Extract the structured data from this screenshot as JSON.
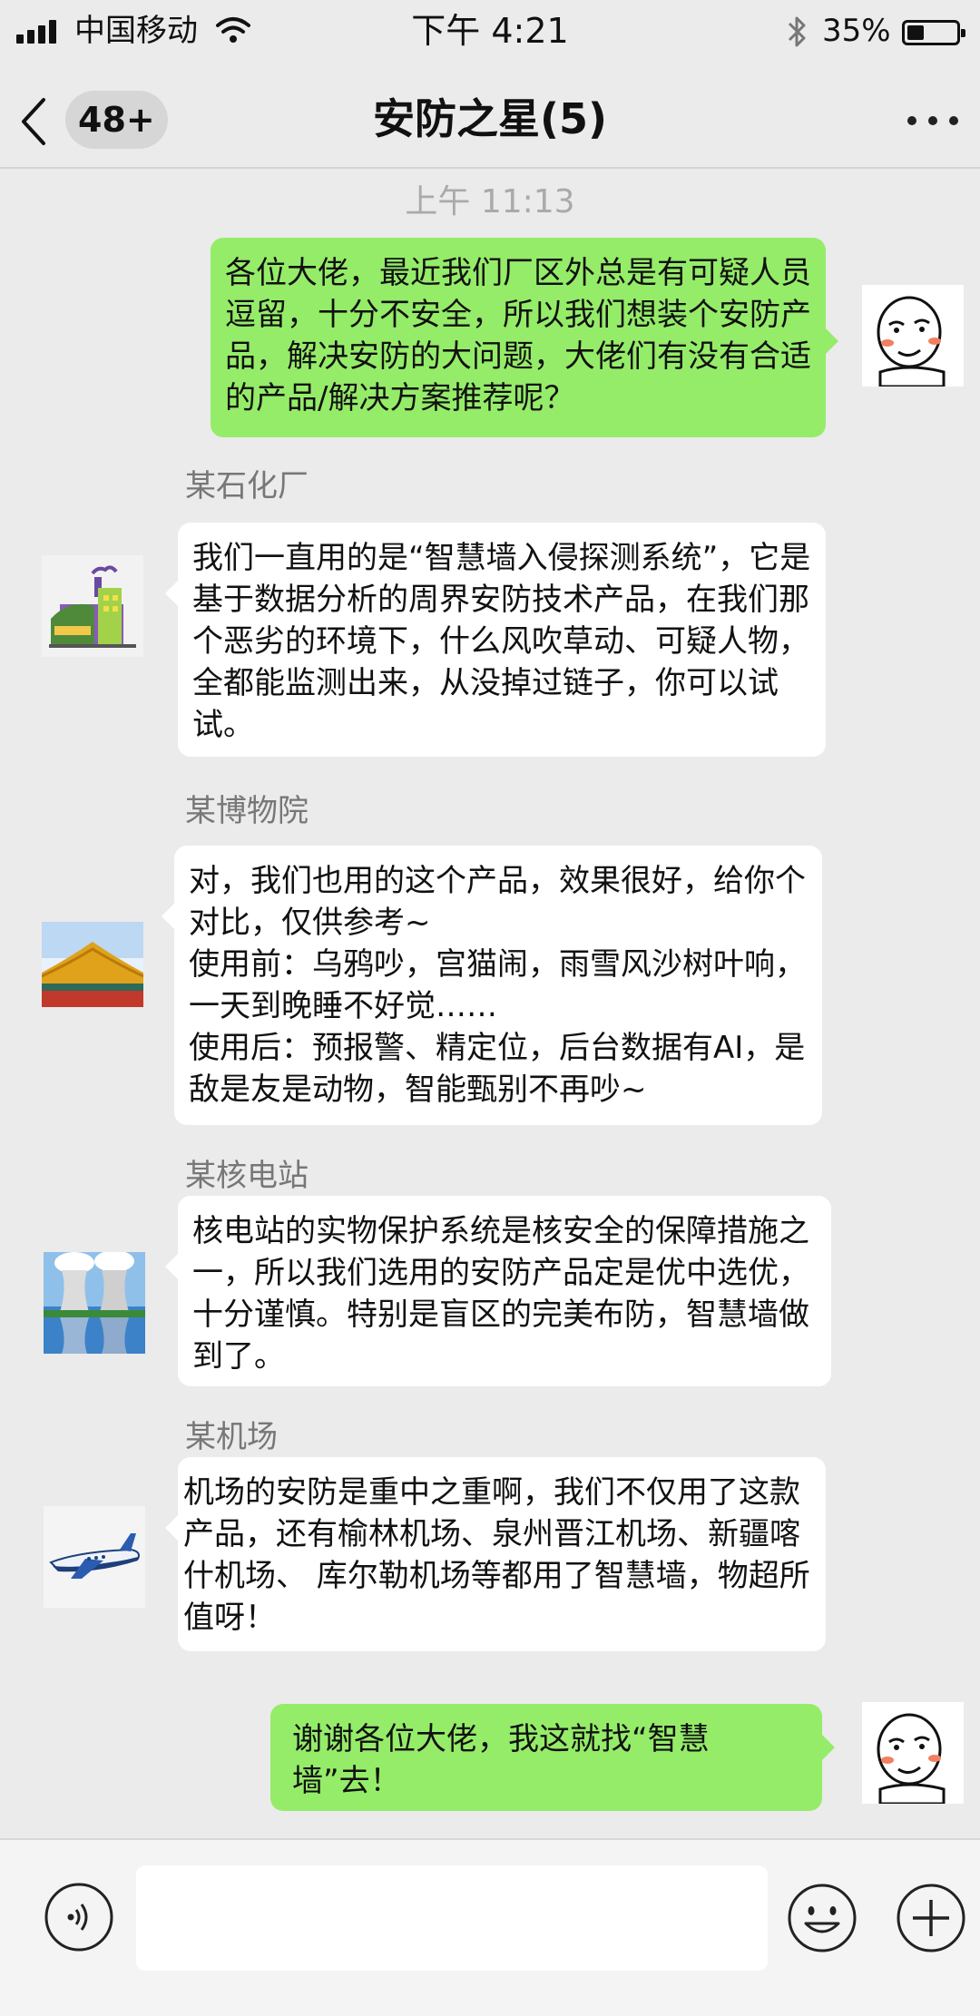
{
  "status_bar": {
    "carrier": "中国移动",
    "time": "下午 4:21",
    "battery_percent_text": "35%",
    "battery_level": 0.35
  },
  "nav": {
    "back_icon": "chevron-left-icon",
    "unread_count": "48+",
    "title": "安防之星(5)",
    "more_icon": "more-horizontal-icon"
  },
  "chat": {
    "timestamp": "上午 11:13",
    "messages": [
      {
        "direction": "outgoing",
        "text": "各位大佬，最近我们厂区外总是有可疑人员逗留，十分不安全，所以我们想装个安防产品，解决安防的大问题，大佬们有没有合适的产品/解决方案推荐呢？"
      },
      {
        "direction": "incoming",
        "sender": "某石化厂",
        "avatar": "factory-avatar",
        "text": "我们一直用的是“智慧墙入侵探测系统”，它是基于数据分析的周界安防技术产品，在我们那个恶劣的环境下，什么风吹草动、可疑人物，全都能监测出来，从没掉过链子，你可以试试。"
      },
      {
        "direction": "incoming",
        "sender": "某博物院",
        "avatar": "palace-roof-avatar",
        "text": "对，我们也用的这个产品，效果很好，给你个对比，仅供参考~\n使用前：乌鸦吵，宫猫闹，雨雪风沙树叶响，一天到晚睡不好觉……\n使用后：预报警、精定位，后台数据有AI，是敌是友是动物，智能甄别不再吵~"
      },
      {
        "direction": "incoming",
        "sender": "某核电站",
        "avatar": "cooling-tower-avatar",
        "text": "核电站的实物保护系统是核安全的保障措施之一，所以我们选用的安防产品定是优中选优，十分谨慎。特别是盲区的完美布防，智慧墙做到了。"
      },
      {
        "direction": "incoming",
        "sender": "某机场",
        "avatar": "airplane-avatar",
        "text": "机场的安防是重中之重啊，我们不仅用了这款产品，还有榆林机场、泉州晋江机场、新疆喀什机场、 库尔勒机场等都用了智慧墙，物超所值呀！"
      },
      {
        "direction": "outgoing",
        "text": "谢谢各位大佬，我这就找“智慧墙”去！"
      }
    ]
  },
  "input_bar": {
    "voice_icon": "voice-icon",
    "emoji_icon": "emoji-icon",
    "plus_icon": "plus-circle-icon",
    "input_value": ""
  },
  "colors": {
    "outgoing_bubble": "#95ec69",
    "incoming_bubble": "#ffffff",
    "background": "#ebebeb"
  }
}
